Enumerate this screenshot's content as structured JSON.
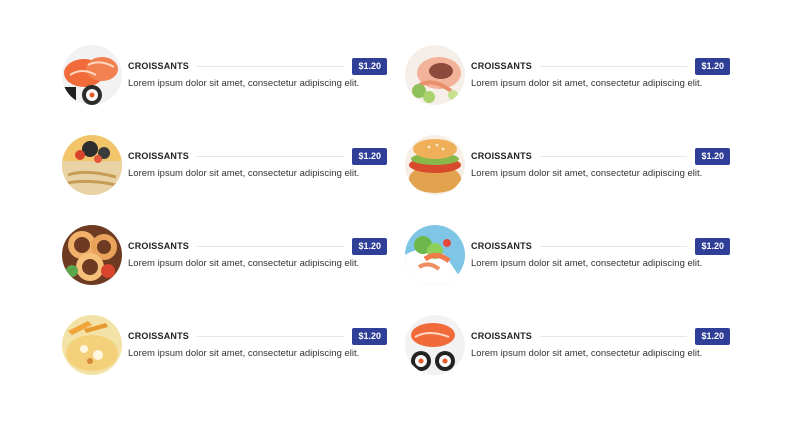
{
  "menu": {
    "items": [
      {
        "name": "CROISSANTS",
        "price": "$1.20",
        "description": "Lorem ipsum dolor sit amet, consectetur adipiscing elit.",
        "image": "sushi-salmon-photo"
      },
      {
        "name": "CROISSANTS",
        "price": "$1.20",
        "description": "Lorem ipsum dolor sit amet, consectetur adipiscing elit.",
        "image": "octopus-salad-photo"
      },
      {
        "name": "CROISSANTS",
        "price": "$1.20",
        "description": "Lorem ipsum dolor sit amet, consectetur adipiscing elit.",
        "image": "bruschetta-olives-photo"
      },
      {
        "name": "CROISSANTS",
        "price": "$1.20",
        "description": "Lorem ipsum dolor sit amet, consectetur adipiscing elit.",
        "image": "burger-photo"
      },
      {
        "name": "CROISSANTS",
        "price": "$1.20",
        "description": "Lorem ipsum dolor sit amet, consectetur adipiscing elit.",
        "image": "calamari-rings-photo"
      },
      {
        "name": "CROISSANTS",
        "price": "$1.20",
        "description": "Lorem ipsum dolor sit amet, consectetur adipiscing elit.",
        "image": "shrimp-salad-photo"
      },
      {
        "name": "CROISSANTS",
        "price": "$1.20",
        "description": "Lorem ipsum dolor sit amet, consectetur adipiscing elit.",
        "image": "pasta-dish-photo"
      },
      {
        "name": "CROISSANTS",
        "price": "$1.20",
        "description": "Lorem ipsum dolor sit amet, consectetur adipiscing elit.",
        "image": "sushi-rolls-photo"
      }
    ]
  },
  "colors": {
    "price_badge": "#2f3f98",
    "divider": "#e6e6e6",
    "text": "#333333"
  }
}
